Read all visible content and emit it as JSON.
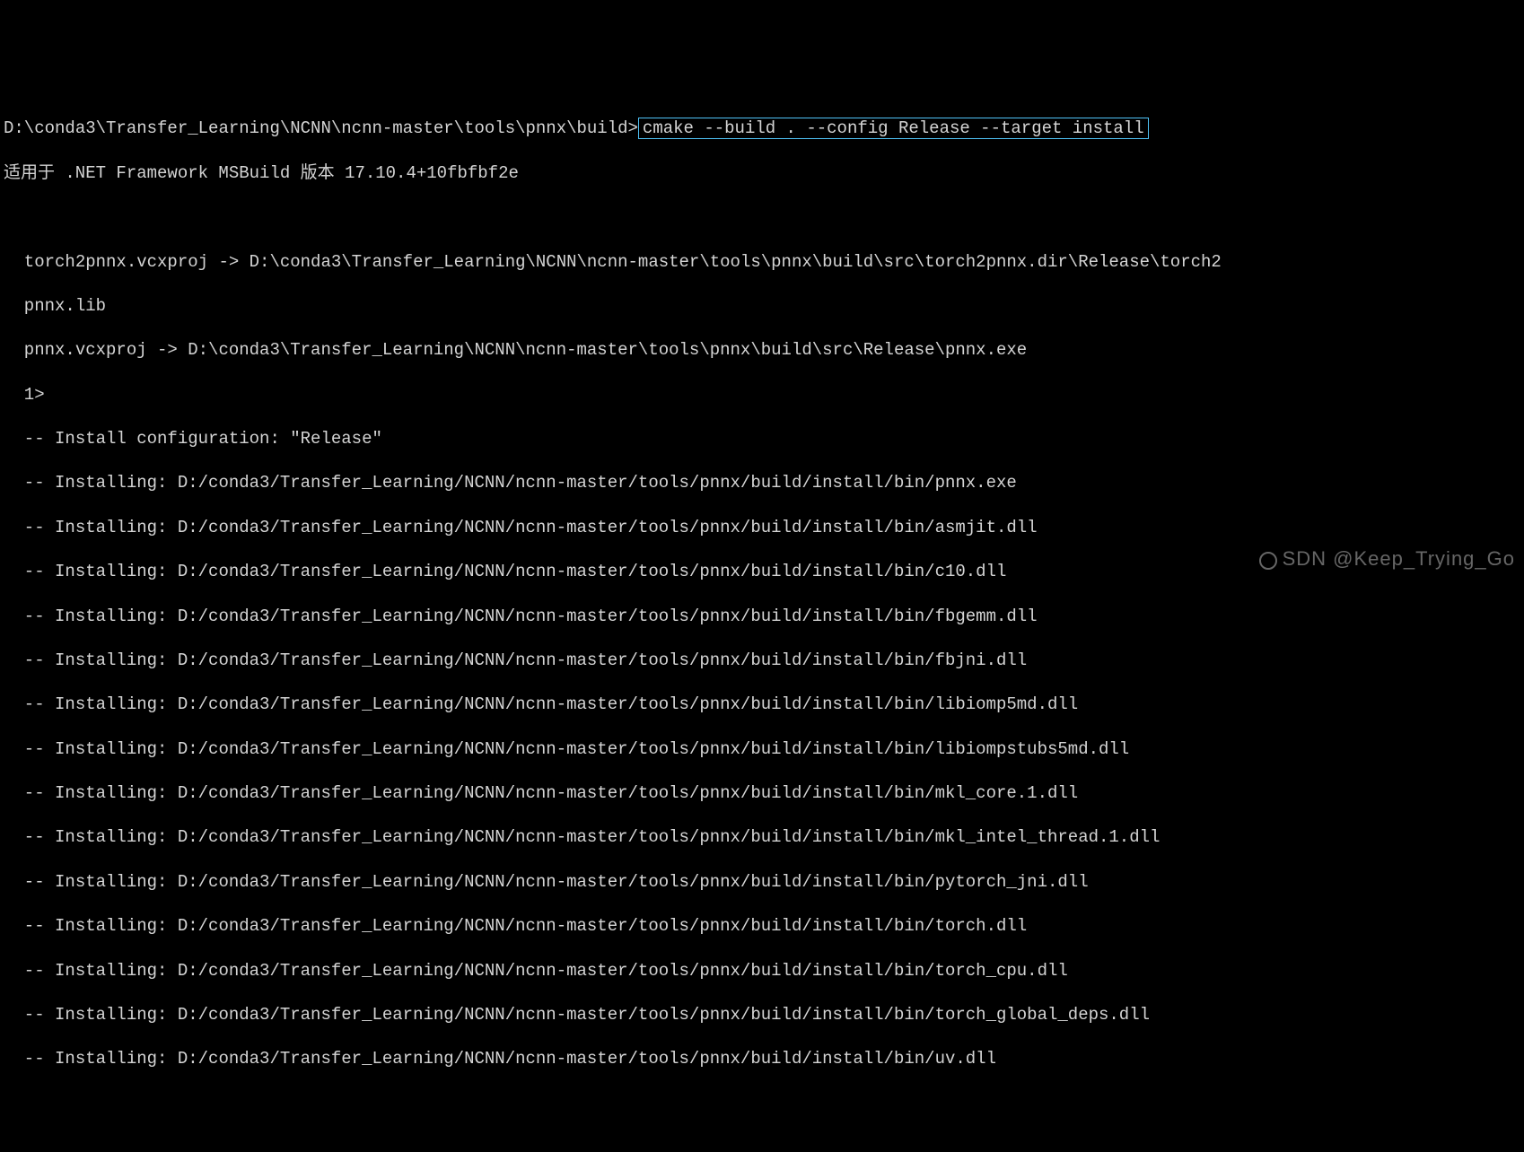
{
  "prompt": {
    "path": "D:\\conda3\\Transfer_Learning\\NCNN\\ncnn-master\\tools\\pnnx\\build>",
    "command": "cmake --build . --config Release --target install"
  },
  "msbuild_line": "适用于 .NET Framework MSBuild 版本 17.10.4+10fbfbf2e",
  "output": {
    "torch2pnnx_line1": "  torch2pnnx.vcxproj -> D:\\conda3\\Transfer_Learning\\NCNN\\ncnn-master\\tools\\pnnx\\build\\src\\torch2pnnx.dir\\Release\\torch2",
    "torch2pnnx_line2": "  pnnx.lib",
    "pnnx_proj": "  pnnx.vcxproj -> D:\\conda3\\Transfer_Learning\\NCNN\\ncnn-master\\tools\\pnnx\\build\\src\\Release\\pnnx.exe",
    "marker": "  1>",
    "install_config": "  -- Install configuration: \"Release\"",
    "installs": [
      "  -- Installing: D:/conda3/Transfer_Learning/NCNN/ncnn-master/tools/pnnx/build/install/bin/pnnx.exe",
      "  -- Installing: D:/conda3/Transfer_Learning/NCNN/ncnn-master/tools/pnnx/build/install/bin/asmjit.dll",
      "  -- Installing: D:/conda3/Transfer_Learning/NCNN/ncnn-master/tools/pnnx/build/install/bin/c10.dll",
      "  -- Installing: D:/conda3/Transfer_Learning/NCNN/ncnn-master/tools/pnnx/build/install/bin/fbgemm.dll",
      "  -- Installing: D:/conda3/Transfer_Learning/NCNN/ncnn-master/tools/pnnx/build/install/bin/fbjni.dll",
      "  -- Installing: D:/conda3/Transfer_Learning/NCNN/ncnn-master/tools/pnnx/build/install/bin/libiomp5md.dll",
      "  -- Installing: D:/conda3/Transfer_Learning/NCNN/ncnn-master/tools/pnnx/build/install/bin/libiompstubs5md.dll",
      "  -- Installing: D:/conda3/Transfer_Learning/NCNN/ncnn-master/tools/pnnx/build/install/bin/mkl_core.1.dll",
      "  -- Installing: D:/conda3/Transfer_Learning/NCNN/ncnn-master/tools/pnnx/build/install/bin/mkl_intel_thread.1.dll",
      "  -- Installing: D:/conda3/Transfer_Learning/NCNN/ncnn-master/tools/pnnx/build/install/bin/pytorch_jni.dll",
      "  -- Installing: D:/conda3/Transfer_Learning/NCNN/ncnn-master/tools/pnnx/build/install/bin/torch.dll",
      "  -- Installing: D:/conda3/Transfer_Learning/NCNN/ncnn-master/tools/pnnx/build/install/bin/torch_cpu.dll",
      "  -- Installing: D:/conda3/Transfer_Learning/NCNN/ncnn-master/tools/pnnx/build/install/bin/torch_global_deps.dll",
      "  -- Installing: D:/conda3/Transfer_Learning/NCNN/ncnn-master/tools/pnnx/build/install/bin/uv.dll"
    ]
  },
  "watermark": "SDN @Keep_Trying_Go"
}
